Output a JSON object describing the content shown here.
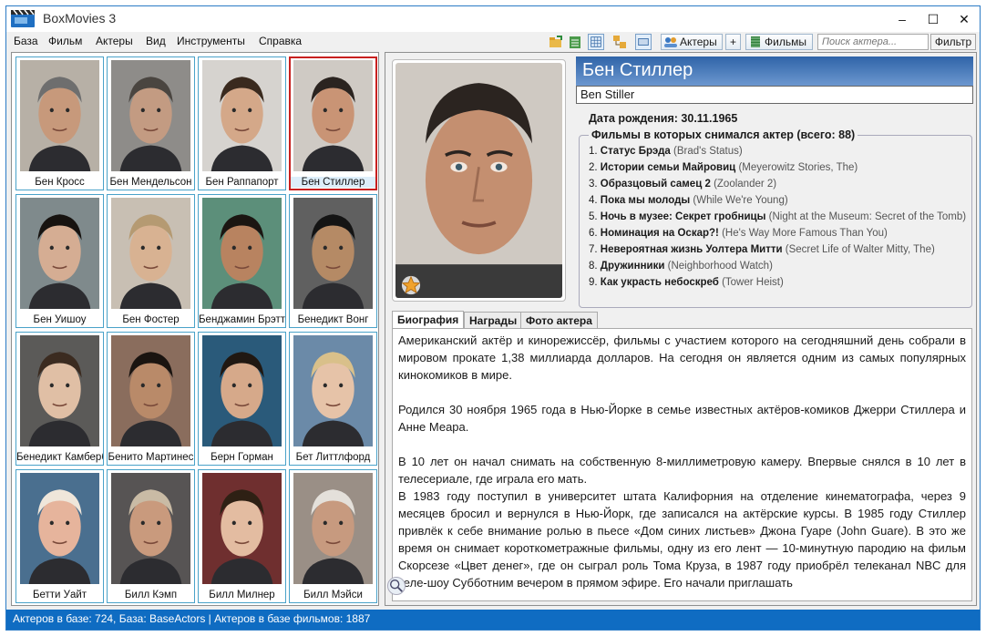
{
  "app": {
    "title": "BoxMovies 3",
    "icon": "film-clapper-icon"
  },
  "window_controls": {
    "minimize": "–",
    "maximize": "☐",
    "close": "✕"
  },
  "menu": [
    "База",
    "Фильм",
    "Актеры",
    "Вид",
    "Инструменты",
    "Справка"
  ],
  "toolbar": {
    "actors_button": "Актеры",
    "plus_button": "+",
    "films_button": "Фильмы",
    "search_placeholder": "Поиск актера...",
    "filter_button": "Фильтр",
    "icons": [
      "folder-export-icon",
      "sheet-export-icon",
      "grid-view-icon",
      "org-view-icon",
      "card-view-icon",
      "actors-icon",
      "films-icon"
    ]
  },
  "actors": [
    {
      "name": "Бен Кросс",
      "selected": false,
      "bg": "#b7b0a6",
      "hair": "#6e6e6e",
      "skin": "#c7997b"
    },
    {
      "name": "Бен Мендельсон",
      "selected": false,
      "bg": "#8e8c89",
      "hair": "#4a4540",
      "skin": "#c39b82"
    },
    {
      "name": "Бен Раппапорт",
      "selected": false,
      "bg": "#d6d3cf",
      "hair": "#3a2a1e",
      "skin": "#d4a889"
    },
    {
      "name": "Бен Стиллер",
      "selected": true,
      "bg": "#cfcac4",
      "hair": "#2b2420",
      "skin": "#c99475"
    },
    {
      "name": "Бен Уишоу",
      "selected": false,
      "bg": "#7f8a8c",
      "hair": "#171310",
      "skin": "#d5ad93"
    },
    {
      "name": "Бен Фостер",
      "selected": false,
      "bg": "#c8bfb3",
      "hair": "#b59a72",
      "skin": "#d8b292"
    },
    {
      "name": "Бенджамин Брэтт",
      "selected": false,
      "bg": "#5c8f7a",
      "hair": "#1b1612",
      "skin": "#b88360"
    },
    {
      "name": "Бенедикт Вонг",
      "selected": false,
      "bg": "#606060",
      "hair": "#141414",
      "skin": "#b58a65"
    },
    {
      "name": "Бенедикт Камбербэтч",
      "selected": false,
      "bg": "#5b5a58",
      "hair": "#3b2b20",
      "skin": "#e0bfa5"
    },
    {
      "name": "Бенито Мартинес",
      "selected": false,
      "bg": "#8a6d5d",
      "hair": "#1a1410",
      "skin": "#b98a69"
    },
    {
      "name": "Берн Горман",
      "selected": false,
      "bg": "#2a5a7a",
      "hair": "#201812",
      "skin": "#d6a98a"
    },
    {
      "name": "Бет Литтлфорд",
      "selected": false,
      "bg": "#6b8aa8",
      "hair": "#d9c08a",
      "skin": "#e6c3a8"
    },
    {
      "name": "Бетти Уайт",
      "selected": false,
      "bg": "#4a6f8f",
      "hair": "#efe6da",
      "skin": "#e6b49c"
    },
    {
      "name": "Билл Кэмп",
      "selected": false,
      "bg": "#575454",
      "hair": "#c9bba5",
      "skin": "#c99a7d"
    },
    {
      "name": "Билл Милнер",
      "selected": false,
      "bg": "#6f2f2f",
      "hair": "#2e2014",
      "skin": "#e3bca1"
    },
    {
      "name": "Билл Мэйси",
      "selected": false,
      "bg": "#9a8f86",
      "hair": "#e4e0da",
      "skin": "#c79a7f"
    }
  ],
  "detail": {
    "name_ru": "Бен Стиллер",
    "name_orig": "Ben Stiller",
    "birth": "Дата рождения: 30.11.1965",
    "films_legend": "Фильмы в которых снимался актер (всего: 88)",
    "films": [
      {
        "num": "1.",
        "ru": "Статус Брэда",
        "orig": "(Brad's Status)"
      },
      {
        "num": "2.",
        "ru": "Истории семьи Майровиц",
        "orig": "(Meyerowitz Stories, The)"
      },
      {
        "num": "3.",
        "ru": "Образцовый самец 2",
        "orig": "(Zoolander 2)"
      },
      {
        "num": "4.",
        "ru": "Пока мы молоды",
        "orig": "(While We're Young)"
      },
      {
        "num": "5.",
        "ru": "Ночь в музее: Секрет гробницы",
        "orig": "(Night at the Museum: Secret of the Tomb)"
      },
      {
        "num": "6.",
        "ru": "Номинация на Оскар?!",
        "orig": "(He's Way More Famous Than You)"
      },
      {
        "num": "7.",
        "ru": "Невероятная жизнь Уолтера Митти",
        "orig": "(Secret Life of Walter Mitty, The)"
      },
      {
        "num": "8.",
        "ru": "Дружинники",
        "orig": "(Neighborhood Watch)"
      },
      {
        "num": "9.",
        "ru": "Как украсть небоскреб",
        "orig": "(Tower Heist)"
      }
    ],
    "tabs": [
      "Биография",
      "Награды",
      "Фото актера"
    ],
    "bio": [
      "Американский актёр и кинорежиссёр, фильмы с участием которого на сегодняшний день собрали в мировом прокате 1,38 миллиарда долларов. На сегодня он является одним из самых популярных кинокомиков в мире.",
      "",
      "Родился 30 ноября 1965 года в Нью-Йорке в семье известных актёров-комиков Джерри Стиллера и Анне Меара.",
      "",
      "В 10 лет он начал снимать на собственную 8-миллиметровую камеру. Впервые снялся в 10 лет в телесериале, где играла его мать.",
      "В 1983 году поступил в университет штата Калифорния на отделение кинематографа, через 9 месяцев бросил и вернулся в Нью-Йорк, где записался на актёрские курсы. В 1985 году Стиллер привлёк к себе внимание ролью в пьесе «Дом синих листьев» Джона Гуаре (John Guare). В это же время он снимает короткометражные фильмы, одну из его лент — 10-минутную пародию на фильм Скорсезе «Цвет денег», где он сыграл роль Тома Круза, в 1987 году приобрёл телеканал NBC для теле-шоу Субботним вечером в прямом эфире. Его начали приглашать"
    ]
  },
  "status": "Актеров в базе: 724, База: BaseActors | Актеров в базе фильмов: 1887",
  "colors": {
    "status_bar": "#0f6cc2",
    "selection": "#c8201f",
    "card_border": "#49a2c9",
    "banner": "#2f64a8"
  }
}
